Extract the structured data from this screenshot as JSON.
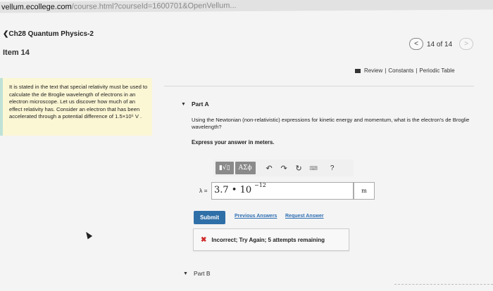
{
  "browser": {
    "url_host": "mastering.pearson-vellum.ecollege.com",
    "url_visible_host": "vellum.ecollege.com",
    "url_rest": "/course.html?courseId=1600701&OpenVellum..."
  },
  "header": {
    "course_link": "Ch28 Quantum Physics-2",
    "item_title": "Item 14",
    "nav_prev": "<",
    "nav_count": "14 of 14",
    "nav_next": ">"
  },
  "top_links": {
    "review": "Review",
    "sep": "|",
    "constants": "Constants",
    "periodic": "Periodic Table"
  },
  "context": {
    "text": "It is stated in the text that special relativity must be used to calculate the de Broglie wavelength of electrons in an electron microscope. Let us discover how much of an effect relativity has. Consider an electron that has been accelerated through a potential difference of 1.5×10⁵ V ."
  },
  "part_a": {
    "label": "Part A",
    "question": "Using the Newtonian (non-relativistic) expressions for kinetic energy and momentum, what is the electron's de Broglie wavelength?",
    "instruction": "Express your answer in meters.",
    "toolbar": {
      "matrix_btn": "▮√▯",
      "greek_btn": "ΑΣϕ",
      "undo_icon": "↶",
      "redo_icon": "↷",
      "reset_icon": "↻",
      "keyboard_icon": "⌨",
      "help_icon": "?"
    },
    "answer_label": "λ =",
    "answer_value": "3.7 • 10",
    "answer_exponent": "−12",
    "unit": "m",
    "submit": "Submit",
    "previous_answers": "Previous Answers",
    "request_answer": "Request Answer",
    "feedback": "Incorrect; Try Again; 5 attempts remaining"
  },
  "part_b": {
    "label": "Part B"
  },
  "colors": {
    "context_bg": "#fbf6d4",
    "submit_bg": "#2f6fa8",
    "link": "#2d6eb3",
    "incorrect": "#d02a2a"
  }
}
